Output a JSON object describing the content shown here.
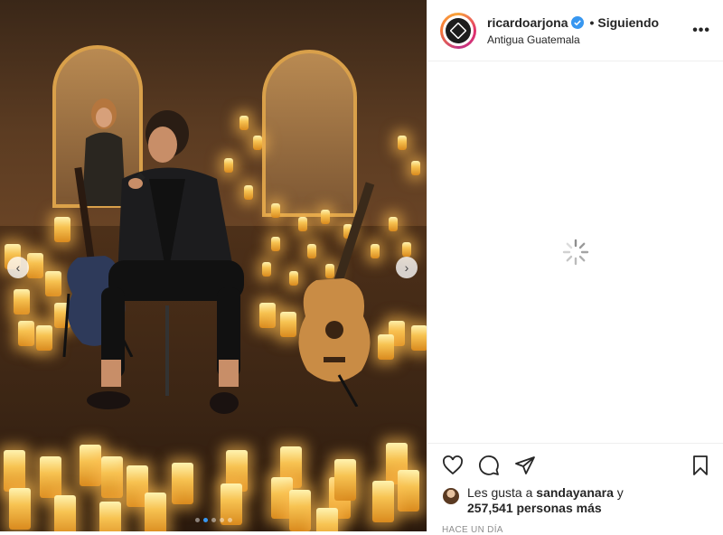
{
  "header": {
    "username": "ricardoarjona",
    "separator": "•",
    "follow_status": "Siguiendo",
    "location": "Antigua Guatemala",
    "more_glyph": "•••"
  },
  "media": {
    "prev_glyph": "‹",
    "next_glyph": "›",
    "carousel_total": 5,
    "carousel_active": 2
  },
  "likes": {
    "prefix": "Les gusta a ",
    "user": "sandayanara",
    "joiner": " y",
    "count": "257,541 personas más"
  },
  "timestamp": "HACE UN DÍA",
  "colors": {
    "verified": "#3897f0",
    "accent": "#3897f0",
    "muted": "#8e8e8e"
  },
  "icons": [
    "heart-icon",
    "comment-icon",
    "share-icon",
    "bookmark-icon",
    "spinner-icon",
    "verified-badge-icon"
  ]
}
